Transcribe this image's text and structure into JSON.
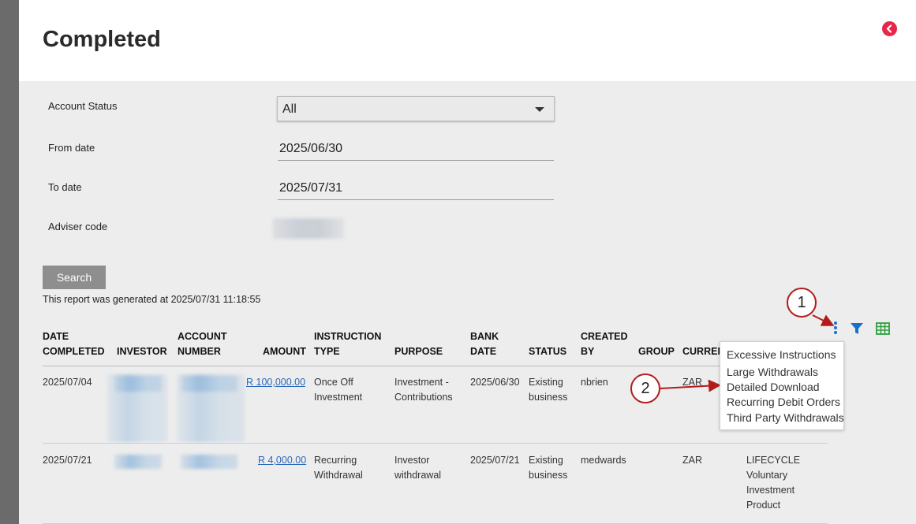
{
  "header": {
    "title": "Completed"
  },
  "form": {
    "account_status_label": "Account Status",
    "account_status_value": "All",
    "from_date_label": "From date",
    "from_date_value": "2025/06/30",
    "to_date_label": "To date",
    "to_date_value": "2025/07/31",
    "adviser_code_label": "Adviser code",
    "search_label": "Search"
  },
  "report": {
    "generated_text": "This report was generated at 2025/07/31 11:18:55"
  },
  "table": {
    "columns": {
      "date_completed": [
        "DATE",
        "COMPLETED"
      ],
      "investor": "INVESTOR",
      "account_number": [
        "ACCOUNT",
        "NUMBER"
      ],
      "amount": "AMOUNT",
      "instruction_type": [
        "INSTRUCTION",
        "TYPE"
      ],
      "purpose": "PURPOSE",
      "bank_date": [
        "BANK",
        "DATE"
      ],
      "status": "STATUS",
      "created_by": [
        "CREATED",
        "BY"
      ],
      "group": "GROUP",
      "currency": "CURREI"
    },
    "rows": [
      {
        "date_completed": "2025/07/04",
        "amount": "R 100,000.00",
        "instruction_type": [
          "Once Off",
          "Investment"
        ],
        "purpose": [
          "Investment -",
          "Contributions"
        ],
        "bank_date": "2025/06/30",
        "status": [
          "Existing",
          "business"
        ],
        "created_by": "nbrien",
        "currency": "ZAR"
      },
      {
        "date_completed": "2025/07/21",
        "amount": "R 4,000.00",
        "instruction_type": [
          "Recurring",
          "Withdrawal"
        ],
        "purpose": [
          "Investor",
          "withdrawal"
        ],
        "bank_date": "2025/07/21",
        "status": [
          "Existing",
          "business"
        ],
        "created_by": "medwards",
        "currency": "ZAR",
        "product": [
          "LIFECYCLE",
          "Voluntary",
          "Investment",
          "Product"
        ]
      }
    ]
  },
  "menu": {
    "items": [
      "Excessive Instructions",
      "Large Withdrawals",
      "Detailed Download",
      "Recurring Debit Orders",
      "Third Party Withdrawals"
    ]
  },
  "annotations": {
    "one": "1",
    "two": "2"
  },
  "colors": {
    "accent_red": "#e8264a",
    "annotation_red": "#b31b1b",
    "filter_blue": "#1a6fc9",
    "grid_green": "#2e9e3e",
    "link_blue": "#2a68b8"
  },
  "icons": {
    "back": "back-chevron-icon",
    "more": "more-vertical-icon",
    "filter": "filter-icon",
    "grid": "grid-table-icon"
  }
}
